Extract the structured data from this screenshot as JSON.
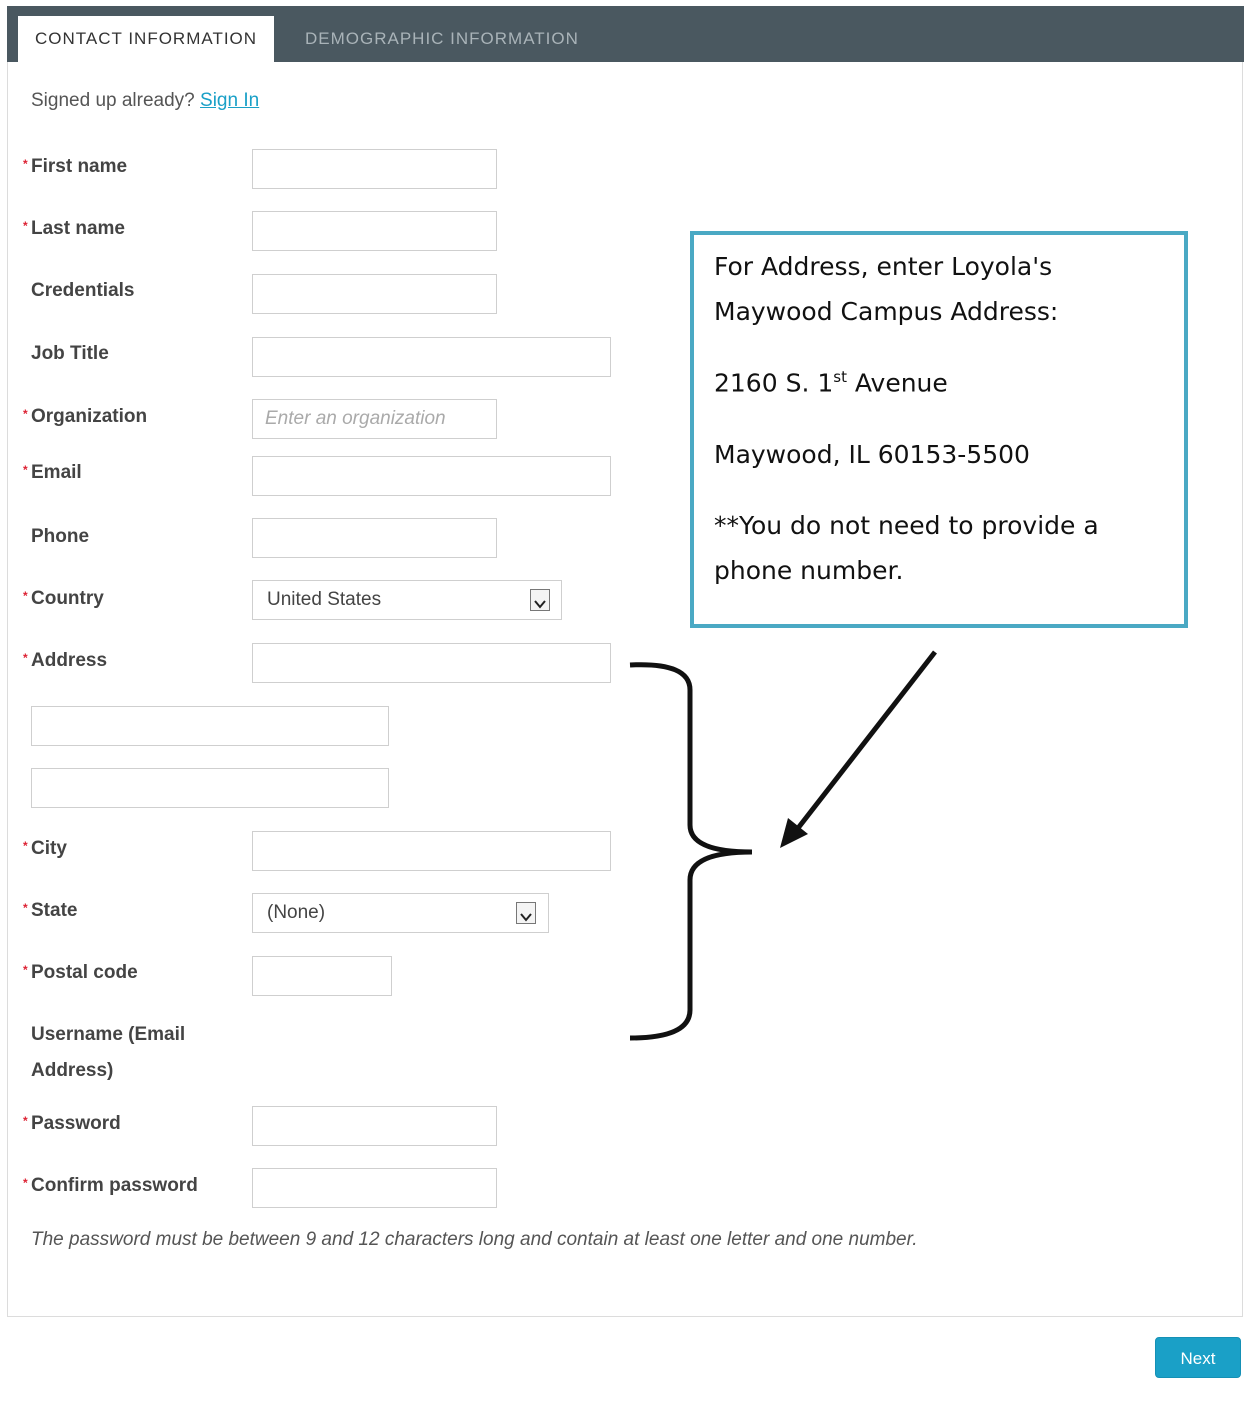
{
  "tabs": [
    {
      "label": "CONTACT INFORMATION"
    },
    {
      "label": "DEMOGRAPHIC INFORMATION"
    }
  ],
  "signup": {
    "prompt": "Signed up already?",
    "link": "Sign In"
  },
  "fields": {
    "first_name": {
      "label": "First name"
    },
    "last_name": {
      "label": "Last name"
    },
    "credentials": {
      "label": "Credentials"
    },
    "job_title": {
      "label": "Job Title"
    },
    "organization": {
      "label": "Organization",
      "placeholder": "Enter an organization"
    },
    "email": {
      "label": "Email"
    },
    "phone": {
      "label": "Phone"
    },
    "country": {
      "label": "Country",
      "value": "United States"
    },
    "address": {
      "label": "Address"
    },
    "city": {
      "label": "City"
    },
    "state": {
      "label": "State",
      "value": "(None)"
    },
    "postal_code": {
      "label": "Postal code"
    },
    "username": {
      "label_line1": "Username (Email",
      "label_line2": "Address)"
    },
    "password": {
      "label": "Password"
    },
    "confirm_password": {
      "label": "Confirm password"
    }
  },
  "required_marker": "*",
  "password_hint": "The password must be between 9 and 12 characters long and contain at least one letter and one number.",
  "next_button": "Next",
  "callout": {
    "line1": "For Address, enter Loyola's",
    "line2": "Maywood Campus Address:",
    "street_prefix": "2160 S. 1",
    "street_sup": "st",
    "street_suffix": " Avenue",
    "city_line": "Maywood, IL 60153-5500",
    "note_line1": "**You do not need to provide a",
    "note_line2": "phone number."
  },
  "colors": {
    "accent": "#1aa0c7",
    "tabbar": "#4a5860",
    "callout_border": "#4aa9c4",
    "required": "#dd2233"
  }
}
